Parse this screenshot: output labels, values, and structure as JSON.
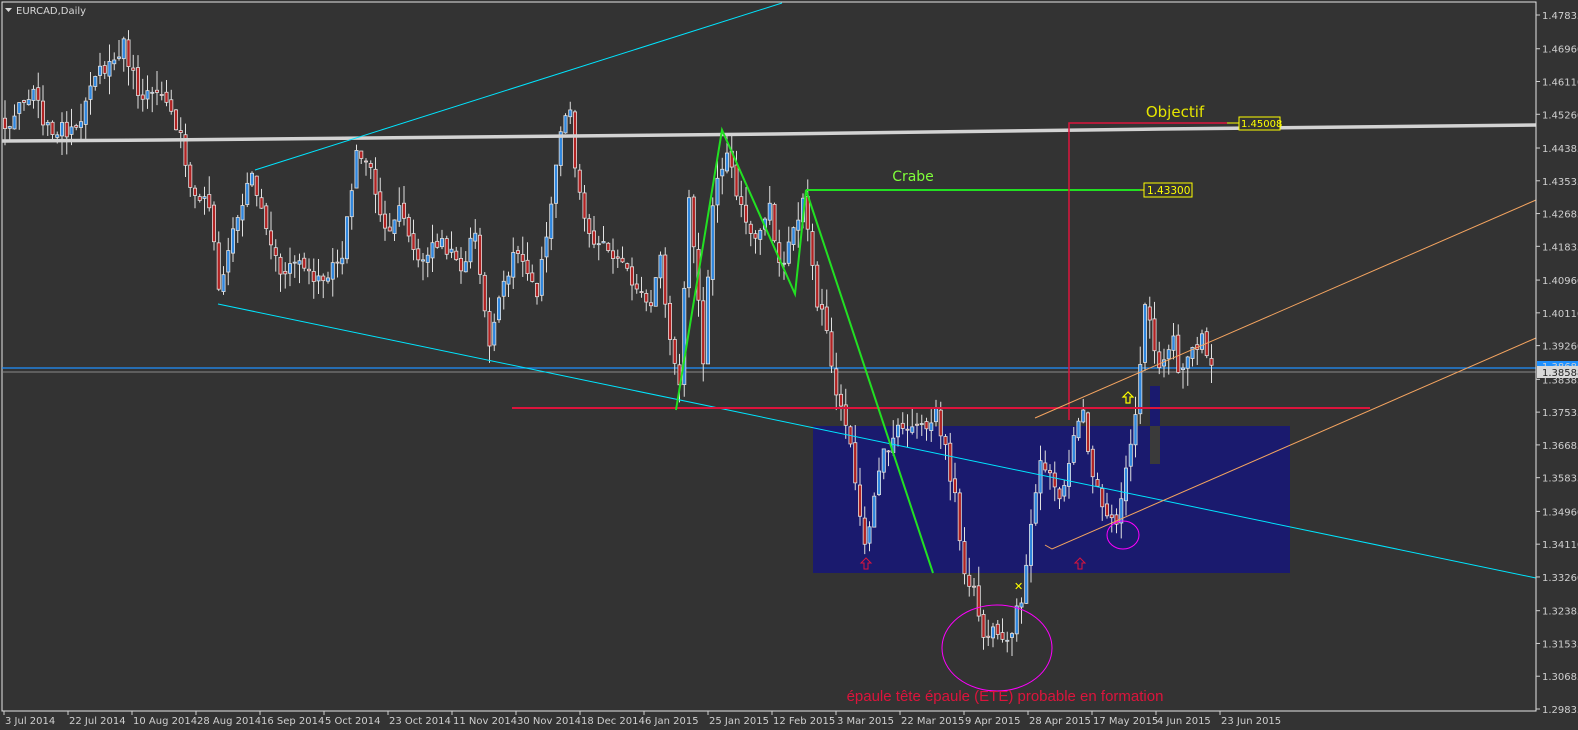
{
  "header": {
    "symbol_title": "EURCAD,Daily",
    "menu_icon": "triangle-down-icon"
  },
  "colors": {
    "background": "#333333",
    "bull_body": "#2e86de",
    "bear_body": "#b02222",
    "candle_outline": "#e0e0e0",
    "support_line": "#dc143c",
    "zone": "#1a1a6e",
    "harmonic": "#22e022",
    "channel": "#f4a460",
    "trend": "#00e5ff",
    "neckline": "#d3d3d3",
    "bid": "#1e90ff",
    "ask": "#8a8a8a",
    "highlight": "#ff00ff",
    "label_box": "#ffff00"
  },
  "annotations": {
    "objectif_label": "Objectif",
    "objectif_price": "1.45008",
    "crabe_label": "Crabe",
    "crabe_price": "1.43300",
    "pattern_note": "épaule tête épaule (ETE) probable en formation",
    "bid_price": "1.38686",
    "ask_price": "1.38588"
  },
  "chart_data": {
    "type": "candlestick",
    "title": "EURCAD,Daily",
    "ylim": [
      1.29835,
      1.47835
    ],
    "y_ticks": [
      "1.47835",
      "1.46960",
      "1.46110",
      "1.45260",
      "1.44385",
      "1.43535",
      "1.42685",
      "1.41835",
      "1.40960",
      "1.40110",
      "1.39260",
      "1.38385",
      "1.37535",
      "1.36685",
      "1.35835",
      "1.34960",
      "1.34110",
      "1.33260",
      "1.32385",
      "1.31535",
      "1.30685",
      "1.29835"
    ],
    "x_ticks": [
      "3 Jul 2014",
      "22 Jul 2014",
      "10 Aug 2014",
      "28 Aug 2014",
      "16 Sep 2014",
      "5 Oct 2014",
      "23 Oct 2014",
      "11 Nov 2014",
      "30 Nov 2014",
      "18 Dec 2014",
      "6 Jan 2015",
      "25 Jan 2015",
      "12 Feb 2015",
      "3 Mar 2015",
      "22 Mar 2015",
      "9 Apr 2015",
      "28 Apr 2015",
      "17 May 2015",
      "4 Jun 2015",
      "23 Jun 2015"
    ],
    "bar_count": 255,
    "close_waypoints": [
      [
        0,
        1.4485
      ],
      [
        3,
        1.4537
      ],
      [
        6,
        1.4576
      ],
      [
        9,
        1.4485
      ],
      [
        13,
        1.4485
      ],
      [
        16,
        1.4524
      ],
      [
        20,
        1.4641
      ],
      [
        23,
        1.4667
      ],
      [
        25,
        1.4706
      ],
      [
        28,
        1.4589
      ],
      [
        33,
        1.4563
      ],
      [
        37,
        1.4485
      ],
      [
        39,
        1.433
      ],
      [
        43,
        1.4291
      ],
      [
        45,
        1.407
      ],
      [
        48,
        1.4226
      ],
      [
        52,
        1.4369
      ],
      [
        55,
        1.4226
      ],
      [
        58,
        1.4122
      ],
      [
        62,
        1.4148
      ],
      [
        66,
        1.4096
      ],
      [
        71,
        1.4148
      ],
      [
        74,
        1.4433
      ],
      [
        77,
        1.4381
      ],
      [
        80,
        1.4226
      ],
      [
        83,
        1.4278
      ],
      [
        87,
        1.4148
      ],
      [
        92,
        1.42
      ],
      [
        96,
        1.4122
      ],
      [
        99,
        1.4226
      ],
      [
        102,
        1.3914
      ],
      [
        104,
        1.407
      ],
      [
        108,
        1.4174
      ],
      [
        112,
        1.4044
      ],
      [
        115,
        1.4304
      ],
      [
        117,
        1.4485
      ],
      [
        119,
        1.4537
      ],
      [
        120,
        1.4369
      ],
      [
        123,
        1.42
      ],
      [
        127,
        1.4174
      ],
      [
        132,
        1.4096
      ],
      [
        136,
        1.4044
      ],
      [
        138,
        1.4148
      ],
      [
        140,
        1.394
      ],
      [
        142,
        1.3837
      ],
      [
        144,
        1.4304
      ],
      [
        147,
        1.3889
      ],
      [
        149,
        1.4304
      ],
      [
        152,
        1.4433
      ],
      [
        155,
        1.4278
      ],
      [
        158,
        1.42
      ],
      [
        161,
        1.4278
      ],
      [
        163,
        1.4122
      ],
      [
        166,
        1.4226
      ],
      [
        168,
        1.4304
      ],
      [
        171,
        1.4044
      ],
      [
        173,
        1.3966
      ],
      [
        175,
        1.3785
      ],
      [
        177,
        1.3733
      ],
      [
        179,
        1.3577
      ],
      [
        181,
        1.3422
      ],
      [
        183,
        1.3525
      ],
      [
        185,
        1.3655
      ],
      [
        188,
        1.3707
      ],
      [
        192,
        1.3733
      ],
      [
        194,
        1.3707
      ],
      [
        196,
        1.3759
      ],
      [
        198,
        1.3655
      ],
      [
        200,
        1.3525
      ],
      [
        202,
        1.3344
      ],
      [
        204,
        1.3292
      ],
      [
        206,
        1.3162
      ],
      [
        208,
        1.3214
      ],
      [
        211,
        1.3162
      ],
      [
        214,
        1.3266
      ],
      [
        216,
        1.3474
      ],
      [
        218,
        1.3629
      ],
      [
        220,
        1.3577
      ],
      [
        222,
        1.3525
      ],
      [
        225,
        1.3681
      ],
      [
        227,
        1.3759
      ],
      [
        229,
        1.3577
      ],
      [
        232,
        1.35
      ],
      [
        234,
        1.3474
      ],
      [
        236,
        1.3603
      ],
      [
        238,
        1.3733
      ],
      [
        240,
        1.4018
      ],
      [
        241,
        1.3992
      ],
      [
        243,
        1.3863
      ],
      [
        246,
        1.394
      ],
      [
        247,
        1.3837
      ],
      [
        249,
        1.3889
      ],
      [
        252,
        1.394
      ],
      [
        254,
        1.386
      ]
    ]
  }
}
